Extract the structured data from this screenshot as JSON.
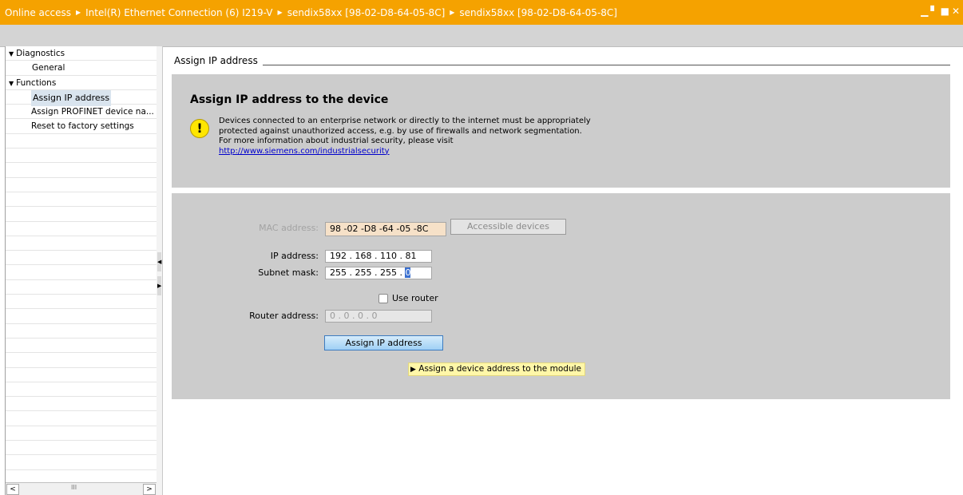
{
  "titlebar": {
    "crumbs": [
      "Online access",
      "Intel(R) Ethernet Connection (6) I219-V",
      "sendix58xx [98-02-D8-64-05-8C]",
      "sendix58xx [98-02-D8-64-05-8C]"
    ],
    "window_controls": [
      "minimize-icon",
      "restore-icon",
      "float-icon",
      "close-icon"
    ]
  },
  "nav": {
    "diagnostics": "Diagnostics",
    "general": "General",
    "functions": "Functions",
    "assign_ip": "Assign IP address",
    "assign_profinet": "Assign PROFINET device na...",
    "reset": "Reset to factory settings"
  },
  "section": {
    "title": "Assign IP address"
  },
  "info": {
    "heading": "Assign IP address to the device",
    "line1": "Devices connected to an enterprise network or directly to the internet must be appropriately",
    "line2": "protected against unauthorized access, e.g. by use of firewalls and network segmentation.",
    "line3": "For more information about industrial security, please visit",
    "link": "http://www.siemens.com/industrialsecurity"
  },
  "form": {
    "mac_label": "MAC address:",
    "mac_value": "98 -02 -D8 -64 -05 -8C",
    "accessible_btn": "Accessible devices",
    "ip_label": "IP address:",
    "ip_value": "192 . 168 . 110 . 81",
    "subnet_label": "Subnet mask:",
    "subnet_prefix": "255 . 255 . 255 . ",
    "subnet_last": "0",
    "use_router": "Use router",
    "router_label": "Router address:",
    "router_value": "0    . 0    . 0    . 0",
    "assign_btn": "Assign IP address",
    "hint": "Assign a device address to the module"
  }
}
